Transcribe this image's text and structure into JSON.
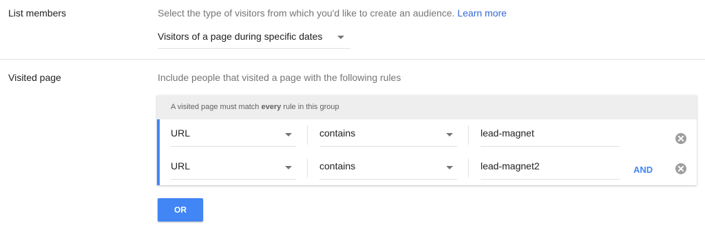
{
  "list_members": {
    "label": "List members",
    "description": "Select the type of visitors from which you'd like to create an audience.",
    "learn_more": "Learn more",
    "selected_type": "Visitors of a page during specific dates"
  },
  "visited_page": {
    "label": "Visited page",
    "description": "Include people that visited a page with the following rules",
    "group_header_prefix": "A visited page must match",
    "group_header_bold": "every",
    "group_header_suffix": "rule in this group",
    "rules": [
      {
        "field": "URL",
        "operator": "contains",
        "value": "lead-magnet"
      },
      {
        "field": "URL",
        "operator": "contains",
        "value": "lead-magnet2"
      }
    ],
    "and_label": "AND",
    "or_button": "OR"
  },
  "icons": {
    "dropdown": "chevron-down-icon",
    "clear": "close-circle-icon"
  },
  "colors": {
    "accent": "#4285f4",
    "link": "#3367d6"
  }
}
